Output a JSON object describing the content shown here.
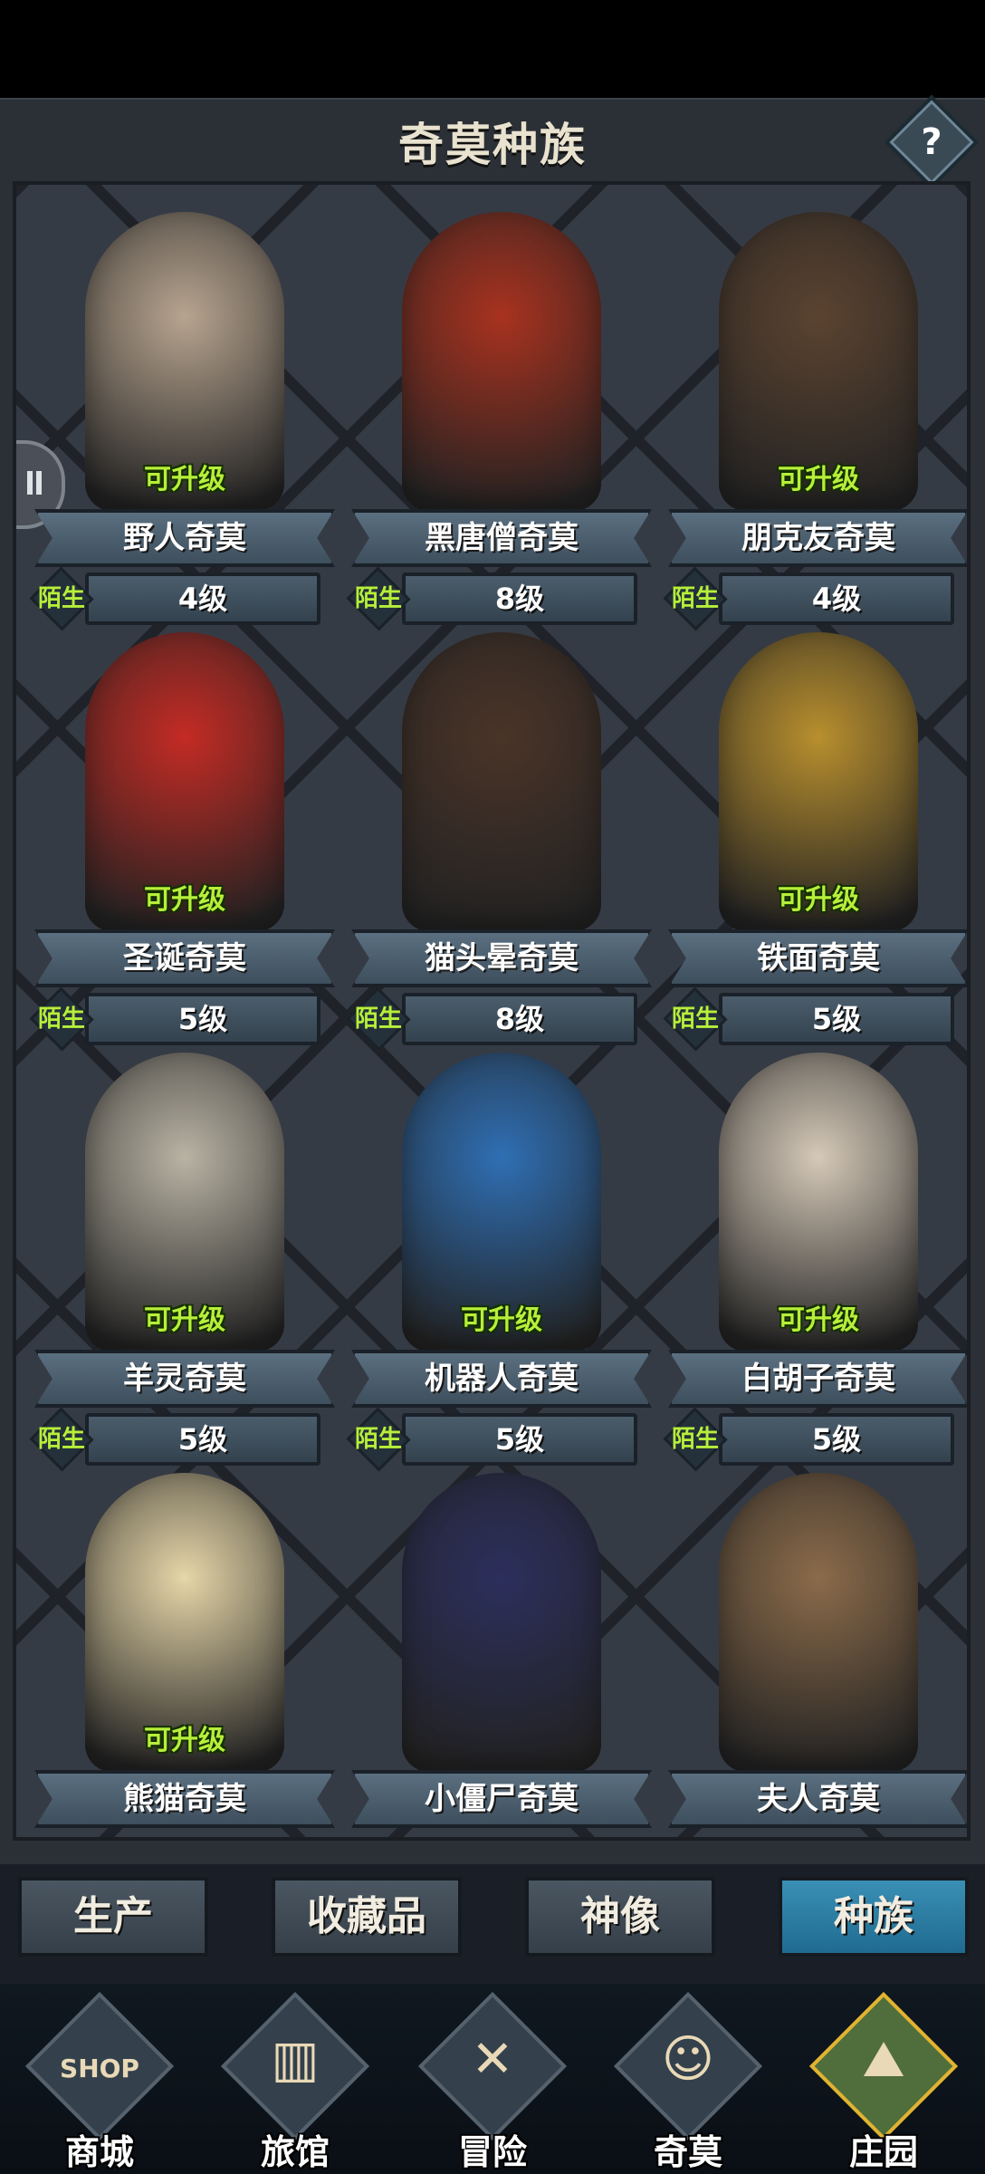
{
  "header": {
    "title": "奇莫种族",
    "help_label": "?"
  },
  "cards": [
    {
      "name": "野人奇莫",
      "level": "4级",
      "status": "陌生",
      "upgrade": "可升级",
      "color": "#b7a48f"
    },
    {
      "name": "黑唐僧奇莫",
      "level": "8级",
      "status": "陌生",
      "upgrade": "",
      "color": "#a8321f"
    },
    {
      "name": "朋克友奇莫",
      "level": "4级",
      "status": "陌生",
      "upgrade": "可升级",
      "color": "#5b4330"
    },
    {
      "name": "圣诞奇莫",
      "level": "5级",
      "status": "陌生",
      "upgrade": "可升级",
      "color": "#c42b24"
    },
    {
      "name": "猫头晕奇莫",
      "level": "8级",
      "status": "陌生",
      "upgrade": "",
      "color": "#4a3428"
    },
    {
      "name": "铁面奇莫",
      "level": "5级",
      "status": "陌生",
      "upgrade": "可升级",
      "color": "#b88f2e"
    },
    {
      "name": "羊灵奇莫",
      "level": "5级",
      "status": "陌生",
      "upgrade": "可升级",
      "color": "#b9b3a4"
    },
    {
      "name": "机器人奇莫",
      "level": "5级",
      "status": "陌生",
      "upgrade": "可升级",
      "color": "#2f6fb4"
    },
    {
      "name": "白胡子奇莫",
      "level": "5级",
      "status": "陌生",
      "upgrade": "可升级",
      "color": "#d5c9b8"
    },
    {
      "name": "熊猫奇莫",
      "level": "",
      "status": "",
      "upgrade": "可升级",
      "color": "#e6d6a8"
    },
    {
      "name": "小僵尸奇莫",
      "level": "",
      "status": "",
      "upgrade": "",
      "color": "#2c2f5c"
    },
    {
      "name": "夫人奇莫",
      "level": "",
      "status": "",
      "upgrade": "",
      "color": "#8b6b4a"
    }
  ],
  "subtabs": [
    "生产",
    "收藏品",
    "神像",
    "种族"
  ],
  "subtab_active": "种族",
  "nav": [
    {
      "label": "商城",
      "icon": "shop-icon",
      "glyph": "SHOP"
    },
    {
      "label": "旅馆",
      "icon": "inn-gate-icon",
      "glyph": "▥"
    },
    {
      "label": "冒险",
      "icon": "crossed-swords-icon",
      "glyph": "✕"
    },
    {
      "label": "奇莫",
      "icon": "character-icon",
      "glyph": "☺"
    },
    {
      "label": "庄园",
      "icon": "island-manor-icon",
      "glyph": "⛰"
    }
  ],
  "nav_active": "庄园"
}
